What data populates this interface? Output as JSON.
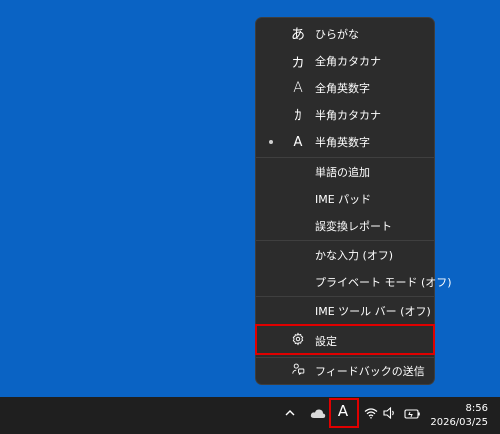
{
  "menu": {
    "input_modes": [
      {
        "glyph": "あ",
        "label": "ひらがな",
        "icon": "hiragana-icon"
      },
      {
        "glyph": "カ",
        "label": "全角カタカナ",
        "icon": "fullwidth-katakana-icon"
      },
      {
        "glyph": "A",
        "label": "全角英数字",
        "icon": "fullwidth-alnum-icon"
      },
      {
        "glyph": "ｶ",
        "label": "半角カタカナ",
        "icon": "halfwidth-katakana-icon"
      },
      {
        "glyph": "A",
        "label": "半角英数字",
        "icon": "halfwidth-alnum-icon",
        "selected": true
      }
    ],
    "tools": [
      {
        "label": "単語の追加"
      },
      {
        "label": "IME パッド"
      },
      {
        "label": "誤変換レポート"
      }
    ],
    "options": [
      {
        "label": "かな入力 (オフ)"
      },
      {
        "label": "プライベート モード (オフ)"
      }
    ],
    "toolbar_item": {
      "label": "IME ツール バー (オフ)"
    },
    "settings": {
      "label": "設定",
      "icon": "gear-icon"
    },
    "feedback": {
      "label": "フィードバックの送信",
      "icon": "feedback-icon"
    }
  },
  "taskbar": {
    "ime_indicator": "A",
    "clock_time": "8:56",
    "clock_date": "2026/03/25"
  },
  "colors": {
    "desktop": "#0a63c4",
    "menu_bg": "#2c2c2c",
    "taskbar": "#1f1f1f",
    "highlight": "#e00000"
  }
}
